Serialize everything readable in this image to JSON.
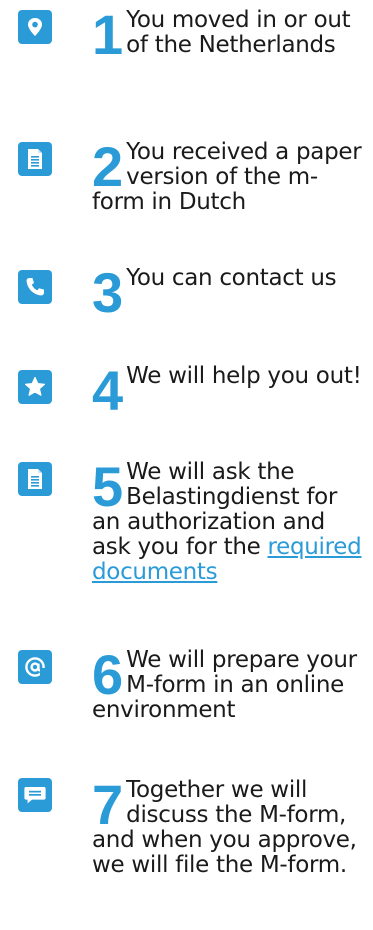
{
  "colors": {
    "accent": "#2b9bd8",
    "text": "#1a1a1a"
  },
  "steps": [
    {
      "number": "1",
      "icon": "location-pin-icon",
      "text": "You moved in or out of the Netherlands"
    },
    {
      "number": "2",
      "icon": "document-icon",
      "text": "You received a paper version of the m-form in Dutch"
    },
    {
      "number": "3",
      "icon": "phone-icon",
      "text": "You can contact us"
    },
    {
      "number": "4",
      "icon": "star-icon",
      "text": "We will help you out!"
    },
    {
      "number": "5",
      "icon": "document-icon",
      "text": "We will ask the Belastingdienst for an authorization and ask you for the",
      "link": "required documents"
    },
    {
      "number": "6",
      "icon": "at-sign-icon",
      "text": "We will  prepare your M-form in an online environment"
    },
    {
      "number": "7",
      "icon": "chat-bubble-icon",
      "text": "Together we will discuss the M-form, and when you approve, we will file the M-form."
    }
  ]
}
